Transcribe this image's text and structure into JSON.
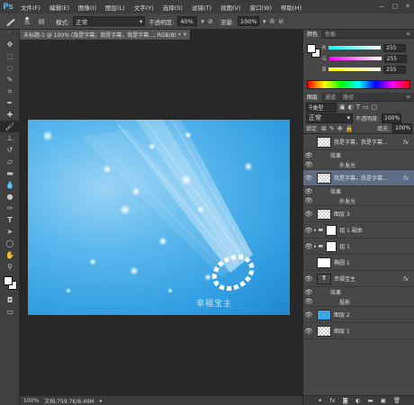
{
  "app": {
    "logo": "Ps"
  },
  "menu": [
    "文件(F)",
    "编辑(E)",
    "图像(I)",
    "图层(L)",
    "文字(Y)",
    "选择(S)",
    "滤镜(T)",
    "视图(V)",
    "窗口(W)",
    "帮助(H)"
  ],
  "window_controls": [
    "—",
    "□",
    "✕"
  ],
  "options_bar": {
    "brush_size": "35",
    "mode_label": "模式:",
    "mode_value": "正常",
    "opacity_label": "不透明度:",
    "opacity_value": "40%",
    "flow_label": "流量:",
    "flow_value": "100%"
  },
  "document": {
    "tab_title": "未标题-1 @ 100% (我是字幕，我是字幕，我是字幕..., RGB/8) *",
    "watermark": "幸福宝主"
  },
  "status_bar": {
    "zoom": "100%",
    "doc_info": "文档:759.7K/8.49M"
  },
  "color_panel": {
    "tabs": [
      "颜色",
      "色板"
    ],
    "channels": [
      {
        "label": "R",
        "value": "255"
      },
      {
        "label": "G",
        "value": "255"
      },
      {
        "label": "B",
        "value": "255"
      }
    ]
  },
  "layers_panel": {
    "tabs": [
      "图层",
      "通道",
      "路径"
    ],
    "filter_kind": "类型",
    "blend_mode": "正常",
    "opacity_label": "不透明度:",
    "opacity_value": "100%",
    "lock_label": "锁定:",
    "fill_label": "填充:",
    "fill_value": "100%",
    "layers": [
      {
        "name": "我是字幕，我是字幕...",
        "fx": "fx",
        "effects_label": "效果",
        "effect": "外发光"
      },
      {
        "name": "我是字幕，我是字幕...",
        "fx": "fx",
        "effects_label": "效果",
        "effect": "外发光"
      },
      {
        "name": "图层 3"
      },
      {
        "name": "组 1 副本"
      },
      {
        "name": "组 1"
      },
      {
        "name": "椭圆 1"
      },
      {
        "name": "幸福宝主",
        "fx": "fx",
        "effects_label": "效果",
        "effect": "投影"
      },
      {
        "name": "图层 2"
      },
      {
        "name": "图层 1"
      }
    ]
  },
  "colors": {
    "accent": "#5aaee8",
    "selected_layer": "#5d6d86",
    "canvas_blue": "#3aa6e6"
  }
}
